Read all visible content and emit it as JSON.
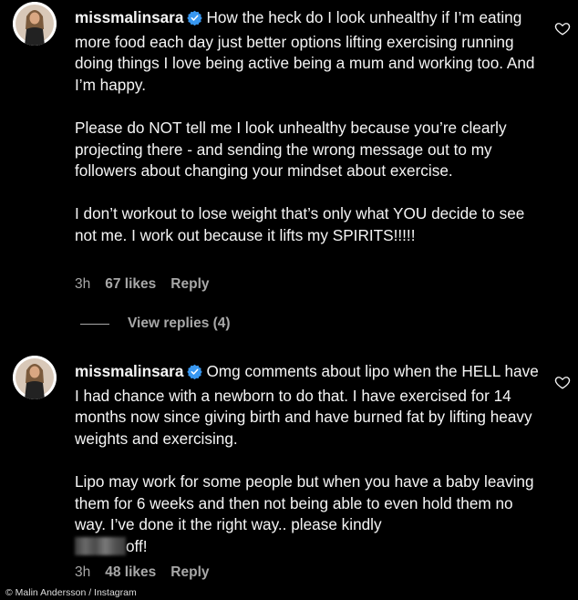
{
  "comments": [
    {
      "username": "missmalinsara",
      "paragraphs": [
        "How the heck do I look unhealthy if I’m eating more food each day just better options lifting exercising running doing things I love being active being a mum and working too. And I’m happy.",
        "Please do NOT tell me I look unhealthy because you’re clearly projecting there - and sending the wrong message out to my followers about changing your mindset about exercise.",
        "I don’t workout to lose weight that’s only what YOU decide to see not me. I work out because it lifts my SPIRITS!!!!!"
      ],
      "time": "3h",
      "likes": "67 likes",
      "reply": "Reply",
      "view_replies": "View replies (4)"
    },
    {
      "username": "missmalinsara",
      "paragraphs": [
        "Omg comments about lipo when the HELL have I had chance with a newborn to do that. I have exercised for 14 months now since giving birth and have burned fat by lifting heavy weights and exercising.",
        "Lipo may work for some people but when you have a baby leaving them for 6 weeks and then not being able to even hold them no way. I’ve done it the right way.. please kindly"
      ],
      "last_line_tail": "off!",
      "time": "3h",
      "likes": "48 likes",
      "reply": "Reply"
    }
  ],
  "credit": "© Malin Andersson / Instagram",
  "colors": {
    "background": "#000000",
    "text": "#f5f5f5",
    "muted": "#a8a8a8",
    "verified": "#3897f0"
  },
  "icons": {
    "verified": "verified-badge-icon",
    "like": "heart-icon"
  }
}
